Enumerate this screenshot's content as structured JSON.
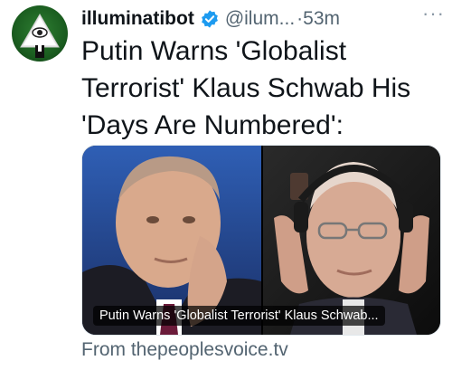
{
  "tweet": {
    "author_name": "illuminatibot",
    "handle": "@ilum...",
    "time": "·53m",
    "more_label": "···",
    "text": "Putin Warns 'Globalist Terrorist' Klaus Schwab His 'Days Are Numbered':"
  },
  "card": {
    "caption": "Putin Warns 'Globalist Terrorist' Klaus Schwab...",
    "source": "From thepeoplesvoice.tv"
  },
  "colors": {
    "verified": "#1d9bf0",
    "muted_text": "#536471",
    "avatar_bg": "#1b5e20"
  },
  "icons": {
    "verified": "verified-badge-icon",
    "more": "more-options-icon"
  }
}
